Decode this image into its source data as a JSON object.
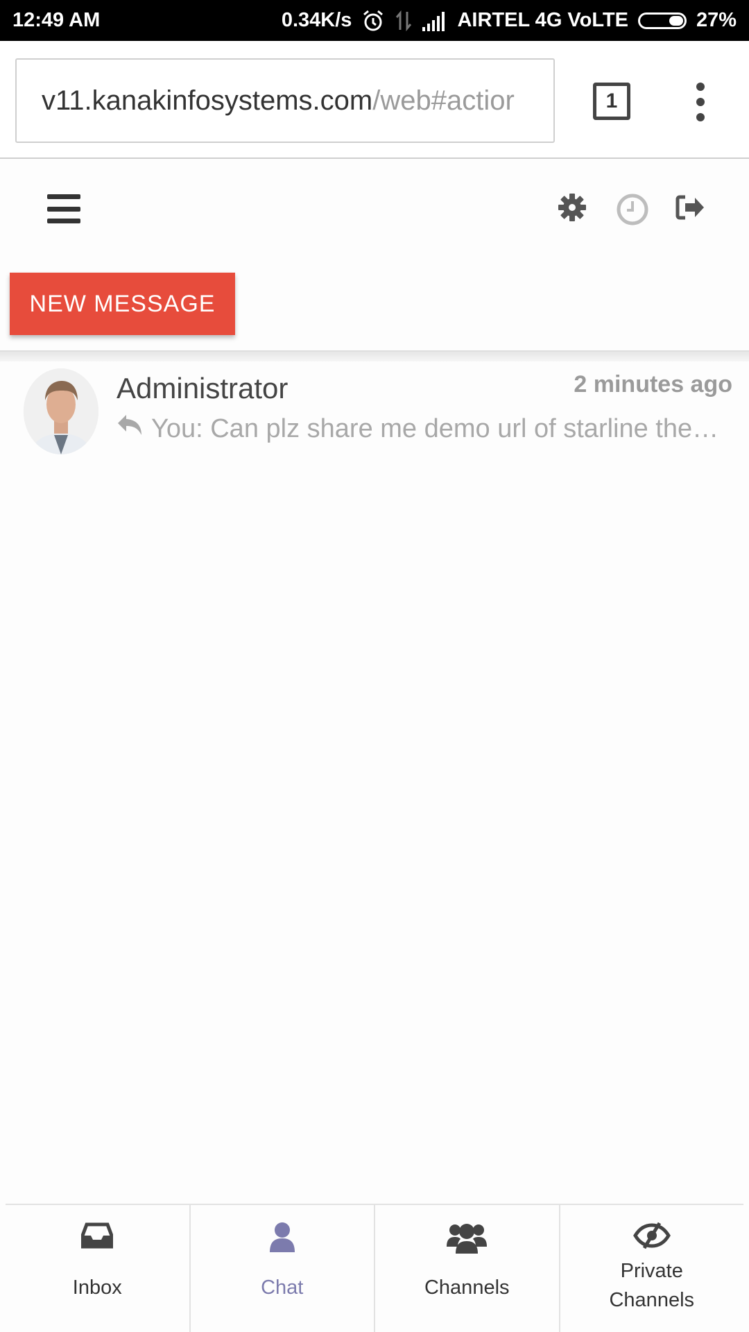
{
  "status_bar": {
    "time": "12:49 AM",
    "speed": "0.34K/s",
    "carrier": "AIRTEL 4G VoLTE",
    "battery": "27%",
    "battery_level": 0.27,
    "icons": [
      "alarm-icon",
      "data-transfer-icon",
      "signal-icon",
      "battery-icon"
    ]
  },
  "browser": {
    "url_domain": "v11.kanakinfosystems.com",
    "url_path": "/web#actior",
    "tab_count": "1"
  },
  "header": {
    "icons": [
      "menu-icon",
      "gear-icon",
      "clock-icon",
      "logout-icon"
    ]
  },
  "actions": {
    "new_message": "NEW MESSAGE"
  },
  "threads": [
    {
      "name": "Administrator",
      "time": "2 minutes ago",
      "preview": "You: Can plz share me demo url of starline the…"
    }
  ],
  "nav": {
    "tabs": [
      {
        "label": "Inbox",
        "icon": "inbox-icon"
      },
      {
        "label": "Chat",
        "icon": "user-icon",
        "active": true
      },
      {
        "label": "Channels",
        "icon": "users-icon"
      },
      {
        "label": "Private\nChannels",
        "icon": "eye-slash-icon"
      }
    ]
  },
  "colors": {
    "accent": "#e74c3c",
    "active_tab": "#7c7bad"
  }
}
